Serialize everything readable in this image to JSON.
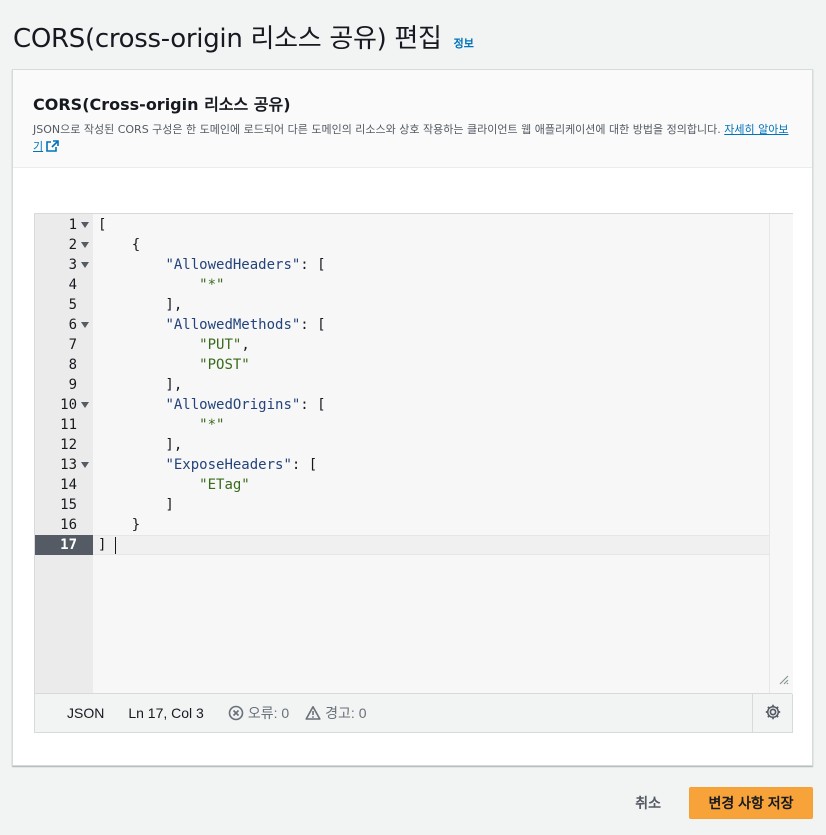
{
  "page": {
    "title": "CORS(cross-origin 리소스 공유) 편집",
    "info_link": "정보"
  },
  "panel": {
    "title": "CORS(Cross-origin 리소스 공유)",
    "description": "JSON으로 작성된 CORS 구성은 한 도메인에 로드되어 다른 도메인의 리소스와 상호 작용하는 클라이언트 웹 애플리케이션에 대한 방법을 정의합니다. ",
    "learn_more": "자세히 알아보기"
  },
  "editor": {
    "lines": [
      {
        "n": "1",
        "code": "[",
        "fold": true
      },
      {
        "n": "2",
        "code": "    {",
        "fold": true
      },
      {
        "n": "3",
        "key": "\"AllowedHeaders\"",
        "rest": ": [",
        "indent": "        ",
        "fold": true
      },
      {
        "n": "4",
        "val": "\"*\"",
        "indent": "            ",
        "fold": false
      },
      {
        "n": "5",
        "code": "        ],",
        "fold": false
      },
      {
        "n": "6",
        "key": "\"AllowedMethods\"",
        "rest": ": [",
        "indent": "        ",
        "fold": true
      },
      {
        "n": "7",
        "val": "\"PUT\"",
        "rest": ",",
        "indent": "            ",
        "fold": false
      },
      {
        "n": "8",
        "val": "\"POST\"",
        "indent": "            ",
        "fold": false
      },
      {
        "n": "9",
        "code": "        ],",
        "fold": false
      },
      {
        "n": "10",
        "key": "\"AllowedOrigins\"",
        "rest": ": [",
        "indent": "        ",
        "fold": true
      },
      {
        "n": "11",
        "val": "\"*\"",
        "indent": "            ",
        "fold": false
      },
      {
        "n": "12",
        "code": "        ],",
        "fold": false
      },
      {
        "n": "13",
        "key": "\"ExposeHeaders\"",
        "rest": ": [",
        "indent": "        ",
        "fold": true
      },
      {
        "n": "14",
        "val": "\"ETag\"",
        "indent": "            ",
        "fold": false
      },
      {
        "n": "15",
        "code": "        ]",
        "fold": false
      },
      {
        "n": "16",
        "code": "    }",
        "fold": false
      },
      {
        "n": "17",
        "code": "]",
        "fold": false,
        "active": true
      }
    ],
    "status": {
      "language": "JSON",
      "position": "Ln 17, Col 3",
      "errors": "오류: 0",
      "warnings": "경고: 0"
    }
  },
  "footer": {
    "cancel_label": "취소",
    "save_label": "변경 사항 저장"
  },
  "colors": {
    "primary_button": "#f7a33a",
    "link": "#0073bb",
    "json_key": "#24437b",
    "json_string": "#3a6a1c"
  },
  "icons": [
    "external-link-icon",
    "fold-arrow-icon",
    "error-circle-icon",
    "warning-triangle-icon",
    "settings-gear-icon",
    "resize-handle-icon"
  ]
}
